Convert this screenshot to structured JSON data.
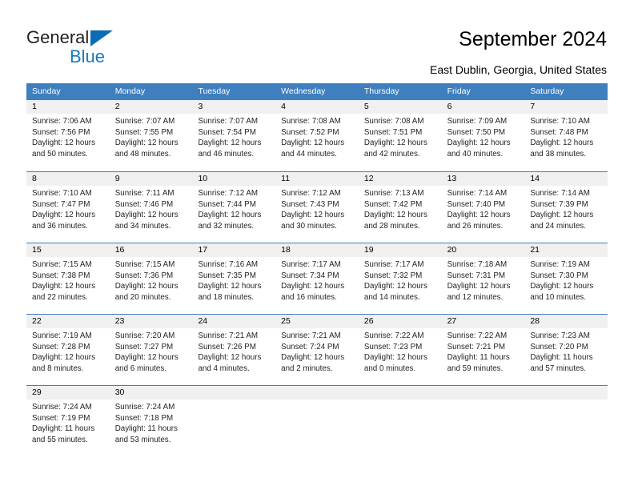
{
  "brand": {
    "name_part1": "General",
    "name_part2": "Blue",
    "triangle_color": "#0b6cb5",
    "blue_text_color": "#1878be"
  },
  "header": {
    "title": "September 2024",
    "location": "East Dublin, Georgia, United States",
    "header_bg": "#3f7fbf",
    "daynum_bg": "#f0f0f0"
  },
  "weekday_headers": [
    "Sunday",
    "Monday",
    "Tuesday",
    "Wednesday",
    "Thursday",
    "Friday",
    "Saturday"
  ],
  "weeks": [
    [
      {
        "day": "1",
        "sunrise": "Sunrise: 7:06 AM",
        "sunset": "Sunset: 7:56 PM",
        "daylight_line1": "Daylight: 12 hours",
        "daylight_line2": "and 50 minutes."
      },
      {
        "day": "2",
        "sunrise": "Sunrise: 7:07 AM",
        "sunset": "Sunset: 7:55 PM",
        "daylight_line1": "Daylight: 12 hours",
        "daylight_line2": "and 48 minutes."
      },
      {
        "day": "3",
        "sunrise": "Sunrise: 7:07 AM",
        "sunset": "Sunset: 7:54 PM",
        "daylight_line1": "Daylight: 12 hours",
        "daylight_line2": "and 46 minutes."
      },
      {
        "day": "4",
        "sunrise": "Sunrise: 7:08 AM",
        "sunset": "Sunset: 7:52 PM",
        "daylight_line1": "Daylight: 12 hours",
        "daylight_line2": "and 44 minutes."
      },
      {
        "day": "5",
        "sunrise": "Sunrise: 7:08 AM",
        "sunset": "Sunset: 7:51 PM",
        "daylight_line1": "Daylight: 12 hours",
        "daylight_line2": "and 42 minutes."
      },
      {
        "day": "6",
        "sunrise": "Sunrise: 7:09 AM",
        "sunset": "Sunset: 7:50 PM",
        "daylight_line1": "Daylight: 12 hours",
        "daylight_line2": "and 40 minutes."
      },
      {
        "day": "7",
        "sunrise": "Sunrise: 7:10 AM",
        "sunset": "Sunset: 7:48 PM",
        "daylight_line1": "Daylight: 12 hours",
        "daylight_line2": "and 38 minutes."
      }
    ],
    [
      {
        "day": "8",
        "sunrise": "Sunrise: 7:10 AM",
        "sunset": "Sunset: 7:47 PM",
        "daylight_line1": "Daylight: 12 hours",
        "daylight_line2": "and 36 minutes."
      },
      {
        "day": "9",
        "sunrise": "Sunrise: 7:11 AM",
        "sunset": "Sunset: 7:46 PM",
        "daylight_line1": "Daylight: 12 hours",
        "daylight_line2": "and 34 minutes."
      },
      {
        "day": "10",
        "sunrise": "Sunrise: 7:12 AM",
        "sunset": "Sunset: 7:44 PM",
        "daylight_line1": "Daylight: 12 hours",
        "daylight_line2": "and 32 minutes."
      },
      {
        "day": "11",
        "sunrise": "Sunrise: 7:12 AM",
        "sunset": "Sunset: 7:43 PM",
        "daylight_line1": "Daylight: 12 hours",
        "daylight_line2": "and 30 minutes."
      },
      {
        "day": "12",
        "sunrise": "Sunrise: 7:13 AM",
        "sunset": "Sunset: 7:42 PM",
        "daylight_line1": "Daylight: 12 hours",
        "daylight_line2": "and 28 minutes."
      },
      {
        "day": "13",
        "sunrise": "Sunrise: 7:14 AM",
        "sunset": "Sunset: 7:40 PM",
        "daylight_line1": "Daylight: 12 hours",
        "daylight_line2": "and 26 minutes."
      },
      {
        "day": "14",
        "sunrise": "Sunrise: 7:14 AM",
        "sunset": "Sunset: 7:39 PM",
        "daylight_line1": "Daylight: 12 hours",
        "daylight_line2": "and 24 minutes."
      }
    ],
    [
      {
        "day": "15",
        "sunrise": "Sunrise: 7:15 AM",
        "sunset": "Sunset: 7:38 PM",
        "daylight_line1": "Daylight: 12 hours",
        "daylight_line2": "and 22 minutes."
      },
      {
        "day": "16",
        "sunrise": "Sunrise: 7:15 AM",
        "sunset": "Sunset: 7:36 PM",
        "daylight_line1": "Daylight: 12 hours",
        "daylight_line2": "and 20 minutes."
      },
      {
        "day": "17",
        "sunrise": "Sunrise: 7:16 AM",
        "sunset": "Sunset: 7:35 PM",
        "daylight_line1": "Daylight: 12 hours",
        "daylight_line2": "and 18 minutes."
      },
      {
        "day": "18",
        "sunrise": "Sunrise: 7:17 AM",
        "sunset": "Sunset: 7:34 PM",
        "daylight_line1": "Daylight: 12 hours",
        "daylight_line2": "and 16 minutes."
      },
      {
        "day": "19",
        "sunrise": "Sunrise: 7:17 AM",
        "sunset": "Sunset: 7:32 PM",
        "daylight_line1": "Daylight: 12 hours",
        "daylight_line2": "and 14 minutes."
      },
      {
        "day": "20",
        "sunrise": "Sunrise: 7:18 AM",
        "sunset": "Sunset: 7:31 PM",
        "daylight_line1": "Daylight: 12 hours",
        "daylight_line2": "and 12 minutes."
      },
      {
        "day": "21",
        "sunrise": "Sunrise: 7:19 AM",
        "sunset": "Sunset: 7:30 PM",
        "daylight_line1": "Daylight: 12 hours",
        "daylight_line2": "and 10 minutes."
      }
    ],
    [
      {
        "day": "22",
        "sunrise": "Sunrise: 7:19 AM",
        "sunset": "Sunset: 7:28 PM",
        "daylight_line1": "Daylight: 12 hours",
        "daylight_line2": "and 8 minutes."
      },
      {
        "day": "23",
        "sunrise": "Sunrise: 7:20 AM",
        "sunset": "Sunset: 7:27 PM",
        "daylight_line1": "Daylight: 12 hours",
        "daylight_line2": "and 6 minutes."
      },
      {
        "day": "24",
        "sunrise": "Sunrise: 7:21 AM",
        "sunset": "Sunset: 7:26 PM",
        "daylight_line1": "Daylight: 12 hours",
        "daylight_line2": "and 4 minutes."
      },
      {
        "day": "25",
        "sunrise": "Sunrise: 7:21 AM",
        "sunset": "Sunset: 7:24 PM",
        "daylight_line1": "Daylight: 12 hours",
        "daylight_line2": "and 2 minutes."
      },
      {
        "day": "26",
        "sunrise": "Sunrise: 7:22 AM",
        "sunset": "Sunset: 7:23 PM",
        "daylight_line1": "Daylight: 12 hours",
        "daylight_line2": "and 0 minutes."
      },
      {
        "day": "27",
        "sunrise": "Sunrise: 7:22 AM",
        "sunset": "Sunset: 7:21 PM",
        "daylight_line1": "Daylight: 11 hours",
        "daylight_line2": "and 59 minutes."
      },
      {
        "day": "28",
        "sunrise": "Sunrise: 7:23 AM",
        "sunset": "Sunset: 7:20 PM",
        "daylight_line1": "Daylight: 11 hours",
        "daylight_line2": "and 57 minutes."
      }
    ],
    [
      {
        "day": "29",
        "sunrise": "Sunrise: 7:24 AM",
        "sunset": "Sunset: 7:19 PM",
        "daylight_line1": "Daylight: 11 hours",
        "daylight_line2": "and 55 minutes."
      },
      {
        "day": "30",
        "sunrise": "Sunrise: 7:24 AM",
        "sunset": "Sunset: 7:18 PM",
        "daylight_line1": "Daylight: 11 hours",
        "daylight_line2": "and 53 minutes."
      },
      {
        "day": "",
        "sunrise": "",
        "sunset": "",
        "daylight_line1": "",
        "daylight_line2": ""
      },
      {
        "day": "",
        "sunrise": "",
        "sunset": "",
        "daylight_line1": "",
        "daylight_line2": ""
      },
      {
        "day": "",
        "sunrise": "",
        "sunset": "",
        "daylight_line1": "",
        "daylight_line2": ""
      },
      {
        "day": "",
        "sunrise": "",
        "sunset": "",
        "daylight_line1": "",
        "daylight_line2": ""
      },
      {
        "day": "",
        "sunrise": "",
        "sunset": "",
        "daylight_line1": "",
        "daylight_line2": ""
      }
    ]
  ]
}
